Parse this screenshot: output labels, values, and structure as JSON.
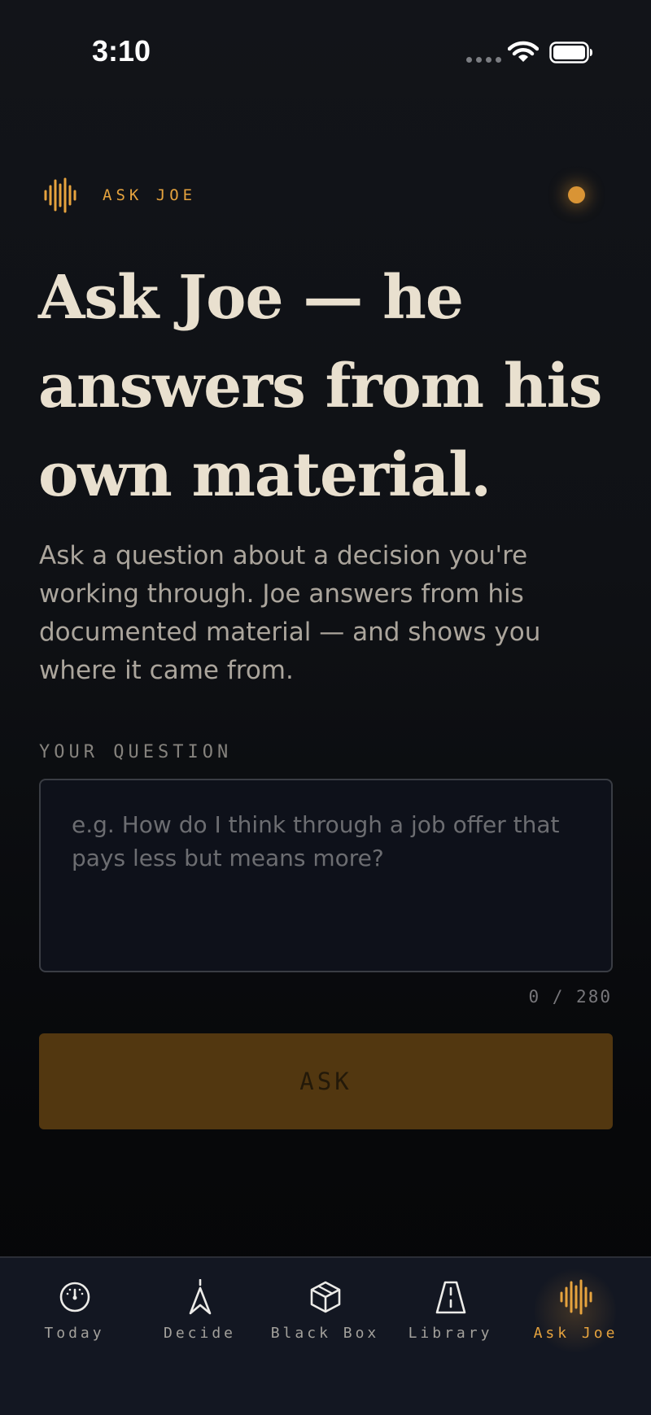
{
  "status_bar": {
    "time": "3:10"
  },
  "brand": {
    "label": "ASK JOE"
  },
  "headline": "Ask Joe — he answers from his own material.",
  "subtitle": "Ask a question about a decision you're working through. Joe answers from his documented material — and shows you where it came from.",
  "question": {
    "label": "YOUR QUESTION",
    "placeholder": "e.g. How do I think through a job offer that pays less but means more?",
    "value": "",
    "counter": "0 / 280"
  },
  "ask_button": {
    "label": "ASK"
  },
  "tabs": [
    {
      "label": "Today",
      "icon": "gauge-icon",
      "active": false
    },
    {
      "label": "Decide",
      "icon": "compass-icon",
      "active": false
    },
    {
      "label": "Black Box",
      "icon": "cube-icon",
      "active": false
    },
    {
      "label": "Library",
      "icon": "road-icon",
      "active": false
    },
    {
      "label": "Ask Joe",
      "icon": "waveform-icon",
      "active": true
    }
  ],
  "colors": {
    "accent": "#e6a33e",
    "background": "#0f1115",
    "headline": "#e9e0cf",
    "button": "#523710"
  }
}
